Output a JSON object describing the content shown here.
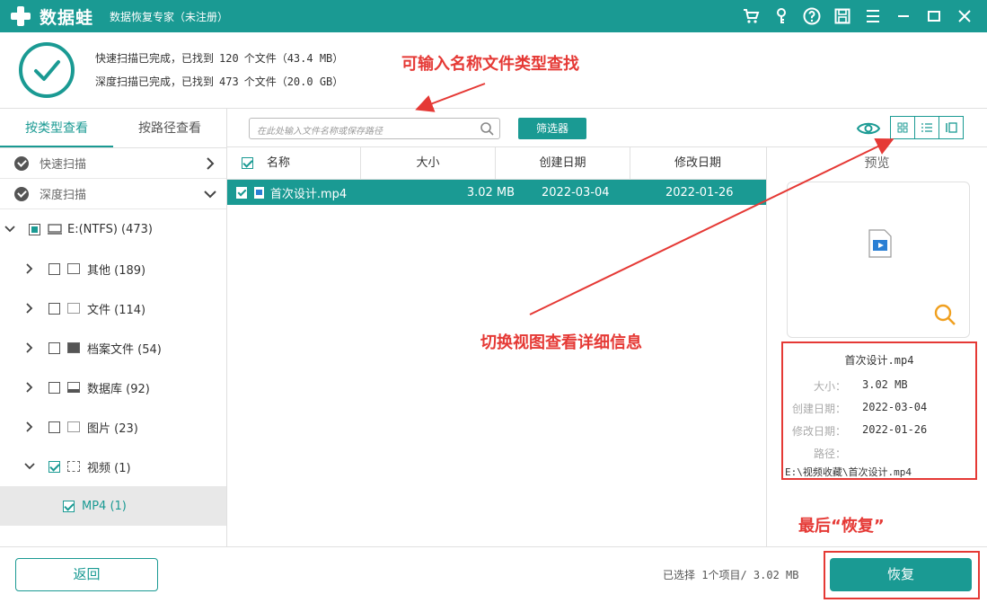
{
  "titlebar": {
    "logo_text": "数据蛙",
    "app_title": "数据恢复专家（未注册）",
    "icons": [
      "cart-icon",
      "key-icon",
      "help-icon",
      "save-icon",
      "menu-icon",
      "minimize-icon",
      "close-icon"
    ]
  },
  "summary": {
    "quick_prefix": "快速扫描已完成，已找到",
    "quick_count": "120",
    "quick_suffix": "个文件（43.4 MB）",
    "deep_prefix": "深度扫描已完成，已找到",
    "deep_count": "473",
    "deep_suffix": "个文件（20.0 GB）"
  },
  "annotations": {
    "search_hint": "可输入名称文件类型查找",
    "view_hint": "切换视图查看详细信息",
    "recover_hint": "最后“恢复”"
  },
  "left": {
    "tabs": [
      "按类型查看",
      "按路径查看"
    ],
    "quick_scan": "快速扫描",
    "deep_scan": "深度扫描",
    "tree": {
      "drive": "E:(NTFS) (473)",
      "items": [
        {
          "label": "其他 (189)"
        },
        {
          "label": "文件 (114)"
        },
        {
          "label": "档案文件 (54)"
        },
        {
          "label": "数据库 (92)"
        },
        {
          "label": "图片 (23)"
        },
        {
          "label": "视频 (1)"
        }
      ],
      "sub_item": "MP4 (1)"
    }
  },
  "toolbar": {
    "search_placeholder": "在此处输入文件名称或保存路径",
    "filter_label": "筛选器"
  },
  "filelist": {
    "columns": [
      "名称",
      "大小",
      "创建日期",
      "修改日期"
    ],
    "rows": [
      {
        "name": "首次设计.mp4",
        "size": "3.02 MB",
        "created": "2022-03-04",
        "modified": "2022-01-26"
      }
    ]
  },
  "preview": {
    "title": "预览",
    "file_name": "首次设计.mp4",
    "size_label": "大小：",
    "size_value": "3.02 MB",
    "created_label": "创建日期：",
    "created_value": "2022-03-04",
    "modified_label": "修改日期：",
    "modified_value": "2022-01-26",
    "path_label": "路径：",
    "path_value": "E:\\视频收藏\\首次设计.mp4"
  },
  "bottom": {
    "back_label": "返回",
    "selection_info": "已选择 1个项目/ 3.02 MB",
    "recover_label": "恢复"
  },
  "colors": {
    "accent": "#1a9a93",
    "annotation": "#e53935"
  }
}
